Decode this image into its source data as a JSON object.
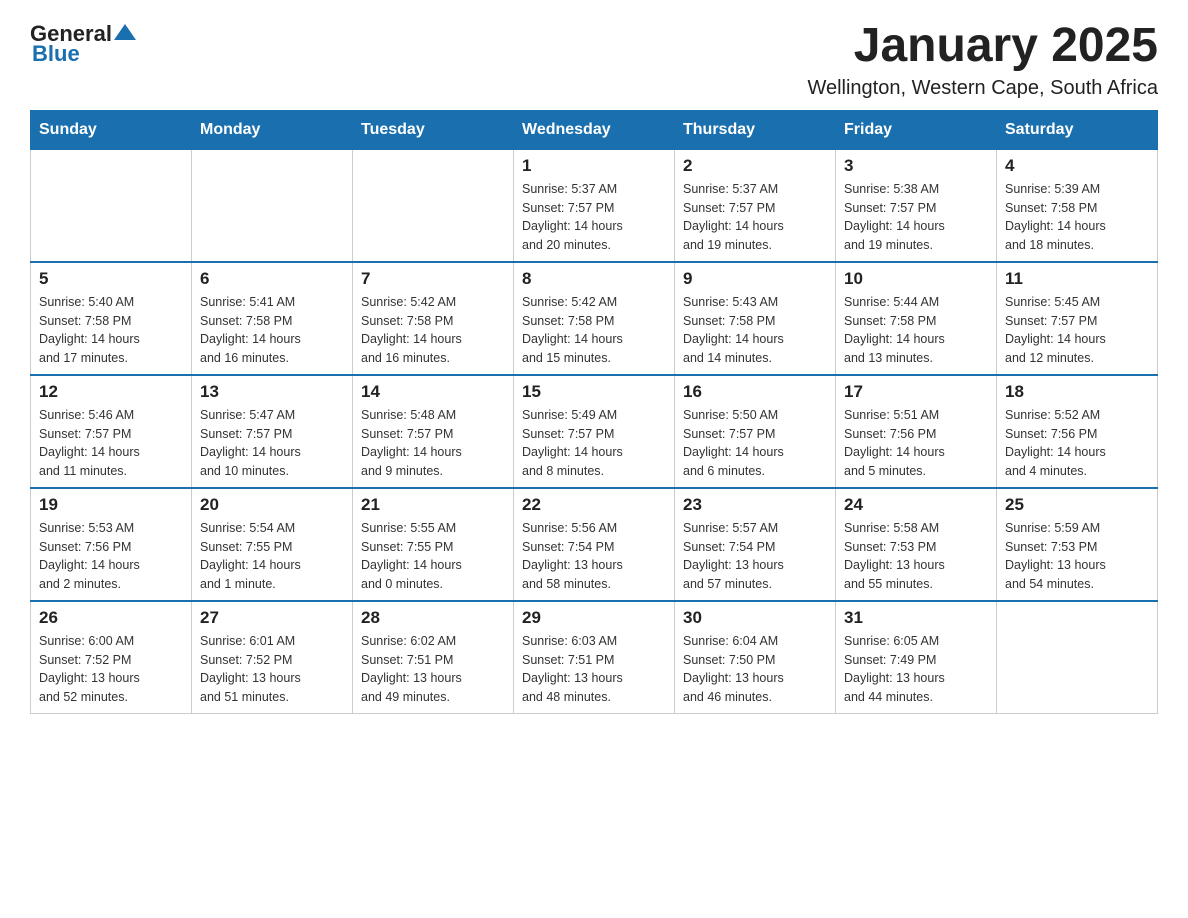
{
  "header": {
    "logo_general": "General",
    "logo_blue": "Blue",
    "title": "January 2025",
    "subtitle": "Wellington, Western Cape, South Africa"
  },
  "days_of_week": [
    "Sunday",
    "Monday",
    "Tuesday",
    "Wednesday",
    "Thursday",
    "Friday",
    "Saturday"
  ],
  "weeks": [
    {
      "days": [
        {
          "number": "",
          "info": ""
        },
        {
          "number": "",
          "info": ""
        },
        {
          "number": "",
          "info": ""
        },
        {
          "number": "1",
          "info": "Sunrise: 5:37 AM\nSunset: 7:57 PM\nDaylight: 14 hours\nand 20 minutes."
        },
        {
          "number": "2",
          "info": "Sunrise: 5:37 AM\nSunset: 7:57 PM\nDaylight: 14 hours\nand 19 minutes."
        },
        {
          "number": "3",
          "info": "Sunrise: 5:38 AM\nSunset: 7:57 PM\nDaylight: 14 hours\nand 19 minutes."
        },
        {
          "number": "4",
          "info": "Sunrise: 5:39 AM\nSunset: 7:58 PM\nDaylight: 14 hours\nand 18 minutes."
        }
      ]
    },
    {
      "days": [
        {
          "number": "5",
          "info": "Sunrise: 5:40 AM\nSunset: 7:58 PM\nDaylight: 14 hours\nand 17 minutes."
        },
        {
          "number": "6",
          "info": "Sunrise: 5:41 AM\nSunset: 7:58 PM\nDaylight: 14 hours\nand 16 minutes."
        },
        {
          "number": "7",
          "info": "Sunrise: 5:42 AM\nSunset: 7:58 PM\nDaylight: 14 hours\nand 16 minutes."
        },
        {
          "number": "8",
          "info": "Sunrise: 5:42 AM\nSunset: 7:58 PM\nDaylight: 14 hours\nand 15 minutes."
        },
        {
          "number": "9",
          "info": "Sunrise: 5:43 AM\nSunset: 7:58 PM\nDaylight: 14 hours\nand 14 minutes."
        },
        {
          "number": "10",
          "info": "Sunrise: 5:44 AM\nSunset: 7:58 PM\nDaylight: 14 hours\nand 13 minutes."
        },
        {
          "number": "11",
          "info": "Sunrise: 5:45 AM\nSunset: 7:57 PM\nDaylight: 14 hours\nand 12 minutes."
        }
      ]
    },
    {
      "days": [
        {
          "number": "12",
          "info": "Sunrise: 5:46 AM\nSunset: 7:57 PM\nDaylight: 14 hours\nand 11 minutes."
        },
        {
          "number": "13",
          "info": "Sunrise: 5:47 AM\nSunset: 7:57 PM\nDaylight: 14 hours\nand 10 minutes."
        },
        {
          "number": "14",
          "info": "Sunrise: 5:48 AM\nSunset: 7:57 PM\nDaylight: 14 hours\nand 9 minutes."
        },
        {
          "number": "15",
          "info": "Sunrise: 5:49 AM\nSunset: 7:57 PM\nDaylight: 14 hours\nand 8 minutes."
        },
        {
          "number": "16",
          "info": "Sunrise: 5:50 AM\nSunset: 7:57 PM\nDaylight: 14 hours\nand 6 minutes."
        },
        {
          "number": "17",
          "info": "Sunrise: 5:51 AM\nSunset: 7:56 PM\nDaylight: 14 hours\nand 5 minutes."
        },
        {
          "number": "18",
          "info": "Sunrise: 5:52 AM\nSunset: 7:56 PM\nDaylight: 14 hours\nand 4 minutes."
        }
      ]
    },
    {
      "days": [
        {
          "number": "19",
          "info": "Sunrise: 5:53 AM\nSunset: 7:56 PM\nDaylight: 14 hours\nand 2 minutes."
        },
        {
          "number": "20",
          "info": "Sunrise: 5:54 AM\nSunset: 7:55 PM\nDaylight: 14 hours\nand 1 minute."
        },
        {
          "number": "21",
          "info": "Sunrise: 5:55 AM\nSunset: 7:55 PM\nDaylight: 14 hours\nand 0 minutes."
        },
        {
          "number": "22",
          "info": "Sunrise: 5:56 AM\nSunset: 7:54 PM\nDaylight: 13 hours\nand 58 minutes."
        },
        {
          "number": "23",
          "info": "Sunrise: 5:57 AM\nSunset: 7:54 PM\nDaylight: 13 hours\nand 57 minutes."
        },
        {
          "number": "24",
          "info": "Sunrise: 5:58 AM\nSunset: 7:53 PM\nDaylight: 13 hours\nand 55 minutes."
        },
        {
          "number": "25",
          "info": "Sunrise: 5:59 AM\nSunset: 7:53 PM\nDaylight: 13 hours\nand 54 minutes."
        }
      ]
    },
    {
      "days": [
        {
          "number": "26",
          "info": "Sunrise: 6:00 AM\nSunset: 7:52 PM\nDaylight: 13 hours\nand 52 minutes."
        },
        {
          "number": "27",
          "info": "Sunrise: 6:01 AM\nSunset: 7:52 PM\nDaylight: 13 hours\nand 51 minutes."
        },
        {
          "number": "28",
          "info": "Sunrise: 6:02 AM\nSunset: 7:51 PM\nDaylight: 13 hours\nand 49 minutes."
        },
        {
          "number": "29",
          "info": "Sunrise: 6:03 AM\nSunset: 7:51 PM\nDaylight: 13 hours\nand 48 minutes."
        },
        {
          "number": "30",
          "info": "Sunrise: 6:04 AM\nSunset: 7:50 PM\nDaylight: 13 hours\nand 46 minutes."
        },
        {
          "number": "31",
          "info": "Sunrise: 6:05 AM\nSunset: 7:49 PM\nDaylight: 13 hours\nand 44 minutes."
        },
        {
          "number": "",
          "info": ""
        }
      ]
    }
  ]
}
